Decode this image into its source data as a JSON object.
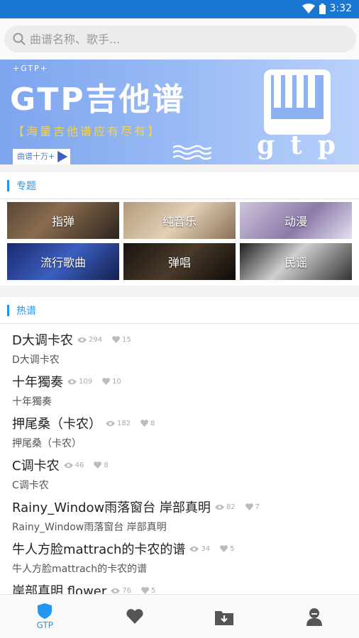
{
  "status_bar": {
    "time": "3:32"
  },
  "search": {
    "placeholder": "曲谱名称、歌手..."
  },
  "banner": {
    "small_text": "+GTP+",
    "title": "GTP吉他谱",
    "subtitle": "【海量吉他谱应有尽有】",
    "badge": "曲谱十万+",
    "logo_letters": "gtp"
  },
  "topics": {
    "header": "专题",
    "items": [
      {
        "label": "指弹"
      },
      {
        "label": "纯音乐"
      },
      {
        "label": "动漫"
      },
      {
        "label": "流行歌曲"
      },
      {
        "label": "弹唱"
      },
      {
        "label": "民谣"
      }
    ]
  },
  "hot": {
    "header": "热谱",
    "songs": [
      {
        "title": "D大调卡农",
        "views": "294",
        "likes": "15",
        "subtitle": "D大调卡农"
      },
      {
        "title": "十年獨奏",
        "views": "109",
        "likes": "10",
        "subtitle": "十年獨奏"
      },
      {
        "title": "押尾桑（卡农）",
        "views": "182",
        "likes": "8",
        "subtitle": "押尾桑（卡农）"
      },
      {
        "title": "C调卡农",
        "views": "46",
        "likes": "8",
        "subtitle": "C调卡农"
      },
      {
        "title": "Rainy_Window雨落窗台 岸部真明",
        "views": "82",
        "likes": "7",
        "subtitle": "Rainy_Window雨落窗台 岸部真明"
      },
      {
        "title": "牛人方脸mattrach的卡农的谱",
        "views": "34",
        "likes": "5",
        "subtitle": "牛人方脸mattrach的卡农的谱"
      },
      {
        "title": "岸部真明 flower",
        "views": "76",
        "likes": "5",
        "subtitle": ""
      }
    ]
  },
  "tabbar": {
    "active_color": "#2196f3",
    "icon_color": "#555555",
    "tabs": [
      {
        "label": "GTP",
        "icon": "shield-icon"
      },
      {
        "label": "",
        "icon": "heart-icon"
      },
      {
        "label": "",
        "icon": "download-box-icon"
      },
      {
        "label": "",
        "icon": "person-icon"
      }
    ]
  }
}
